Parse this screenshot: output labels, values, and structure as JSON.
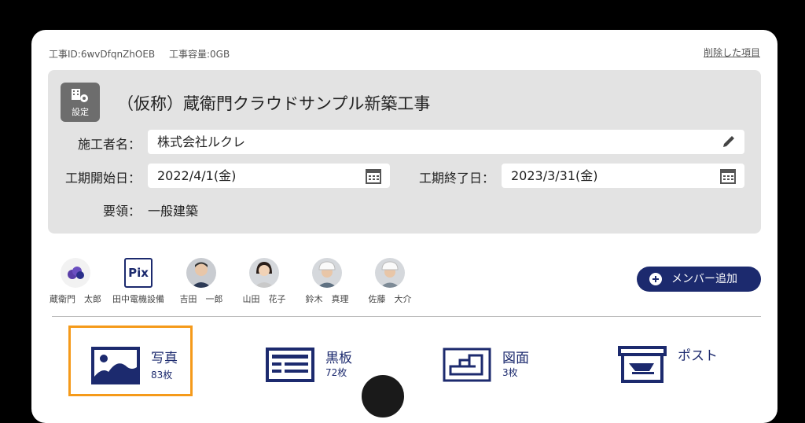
{
  "project_meta": {
    "id_text": "工事ID:6wvDfqnZhOEB",
    "capacity_text": "工事容量:0GB",
    "deleted_items_link": "削除した項目"
  },
  "project": {
    "settings_label": "設定",
    "title": "（仮称）蔵衛門クラウドサンプル新築工事",
    "contractor_label": "施工者名：",
    "contractor_value": "株式会社ルクレ",
    "start_label": "工期開始日：",
    "start_value": "2022/4/1(金)",
    "end_label": "工期終了日：",
    "end_value": "2023/3/31(金)",
    "guideline_label": "要領：",
    "guideline_value": "一般建築"
  },
  "members": [
    {
      "name": "蔵衛門　太郎",
      "icon": "cloud-logo"
    },
    {
      "name": "田中電機設備",
      "icon": "pix-logo"
    },
    {
      "name": "吉田　一郎",
      "icon": "person-avatar"
    },
    {
      "name": "山田　花子",
      "icon": "person-avatar"
    },
    {
      "name": "鈴木　真理",
      "icon": "helmet-avatar"
    },
    {
      "name": "佐藤　大介",
      "icon": "helmet-avatar"
    }
  ],
  "add_member_label": "メンバー追加",
  "pix_text": "Pix",
  "tiles": [
    {
      "label": "写真",
      "count": "83枚",
      "icon": "photo-icon"
    },
    {
      "label": "黒板",
      "count": "72枚",
      "icon": "blackboard-icon"
    },
    {
      "label": "図面",
      "count": "3枚",
      "icon": "floorplan-icon"
    },
    {
      "label": "ポスト",
      "count": "",
      "icon": "mailbox-icon"
    }
  ],
  "colors": {
    "accent": "#1c2a6e",
    "selected": "#f59a1a",
    "panel": "#e3e3e3"
  }
}
